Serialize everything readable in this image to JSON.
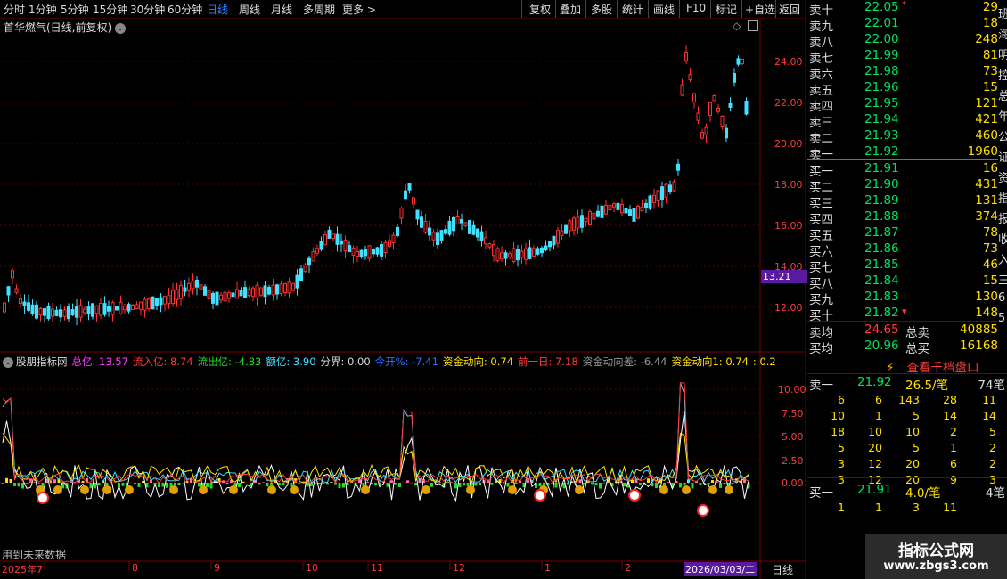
{
  "toolbar": {
    "periods": [
      "分时",
      "1分钟",
      "5分钟",
      "15分钟",
      "30分钟",
      "60分钟",
      "日线",
      "周线",
      "月线",
      "多周期",
      "更多 >"
    ],
    "active_period": "日线",
    "actions": [
      "复权",
      "叠加",
      "多股",
      "统计",
      "画线",
      "F10",
      "标记",
      "+自选",
      "返回"
    ]
  },
  "chart_title": "首华燃气(日线,前复权)",
  "price_axis": [
    "24.00",
    "22.00",
    "20.00",
    "18.00",
    "16.00",
    "14.00",
    "12.00"
  ],
  "current_price_tag": "13.21",
  "indicator": {
    "name": "股朋指标网",
    "fields": [
      {
        "label": "总亿: 13.57",
        "color": "#ff40ff"
      },
      {
        "label": "流入亿: 8.74",
        "color": "#ff3b3b"
      },
      {
        "label": "流出亿: -4.83",
        "color": "#22dd22"
      },
      {
        "label": "额亿: 3.90",
        "color": "#40e0ff"
      },
      {
        "label": "分界: 0.00",
        "color": "#dddddd"
      },
      {
        "label": "今开%: -7.41",
        "color": "#3070ff"
      },
      {
        "label": "资金动向: 0.74",
        "color": "#ffe000"
      },
      {
        "label": "前一日: 7.18",
        "color": "#ff3b3b"
      },
      {
        "label": "资金动向差: -6.44",
        "color": "#999999"
      },
      {
        "label": "资金动向1: 0.74",
        "color": "#ffe000"
      },
      {
        "label": ": 0.2",
        "color": "#ffe000"
      }
    ],
    "axis": [
      "10.00",
      "7.50",
      "5.00",
      "2.50",
      "0.00"
    ],
    "future_note": "用到未来数据"
  },
  "time_axis": [
    "2025年7",
    "8",
    "9",
    "10",
    "11",
    "12",
    "1",
    "2"
  ],
  "cursor_date": "2026/03/03/二",
  "period_label": "日线",
  "order_book": {
    "sells": [
      {
        "label": "卖十",
        "price": "22.05",
        "vol": "29"
      },
      {
        "label": "卖九",
        "price": "22.01",
        "vol": "18"
      },
      {
        "label": "卖八",
        "price": "22.00",
        "vol": "248"
      },
      {
        "label": "卖七",
        "price": "21.99",
        "vol": "81"
      },
      {
        "label": "卖六",
        "price": "21.98",
        "vol": "73"
      },
      {
        "label": "卖五",
        "price": "21.96",
        "vol": "15"
      },
      {
        "label": "卖四",
        "price": "21.95",
        "vol": "121"
      },
      {
        "label": "卖三",
        "price": "21.94",
        "vol": "421"
      },
      {
        "label": "卖二",
        "price": "21.93",
        "vol": "460"
      },
      {
        "label": "卖一",
        "price": "21.92",
        "vol": "1960"
      }
    ],
    "buys": [
      {
        "label": "买一",
        "price": "21.91",
        "vol": "16"
      },
      {
        "label": "买二",
        "price": "21.90",
        "vol": "431"
      },
      {
        "label": "买三",
        "price": "21.89",
        "vol": "131"
      },
      {
        "label": "买四",
        "price": "21.88",
        "vol": "374"
      },
      {
        "label": "买五",
        "price": "21.87",
        "vol": "78"
      },
      {
        "label": "买六",
        "price": "21.86",
        "vol": "73"
      },
      {
        "label": "买七",
        "price": "21.85",
        "vol": "46"
      },
      {
        "label": "买八",
        "price": "21.84",
        "vol": "15"
      },
      {
        "label": "买九",
        "price": "21.83",
        "vol": "130"
      },
      {
        "label": "买十",
        "price": "21.82",
        "vol": "148"
      }
    ],
    "avg_sell_label": "卖均",
    "avg_sell_price": "24.65",
    "total_sell_label": "总卖",
    "total_sell": "40885",
    "avg_buy_label": "买均",
    "avg_buy_price": "20.96",
    "total_buy_label": "总买",
    "total_buy": "16168"
  },
  "depth": {
    "button": "查看千档盘口",
    "sell1": {
      "label": "卖一",
      "price": "21.92",
      "per": "26.5/笔",
      "count": "74笔"
    },
    "sell_grid": [
      [
        "6",
        "6",
        "143",
        "28",
        "11"
      ],
      [
        "10",
        "1",
        "5",
        "14",
        "14"
      ],
      [
        "18",
        "10",
        "10",
        "2",
        "5"
      ],
      [
        "5",
        "20",
        "5",
        "1",
        "2"
      ],
      [
        "3",
        "12",
        "20",
        "6",
        "2"
      ],
      [
        "3",
        "12",
        "20",
        "9",
        "3"
      ]
    ],
    "buy1": {
      "label": "买一",
      "price": "21.91",
      "per": "4.0/笔",
      "count": "4笔"
    },
    "buy_grid": [
      [
        "1",
        "1",
        "3",
        "11"
      ]
    ]
  },
  "watermark": {
    "title": "指标公式网",
    "url": "www.zbgs3.com"
  },
  "edge_text": [
    "班",
    "海",
    "明",
    "控",
    "总",
    "年",
    "公",
    "证",
    "资",
    "指",
    "报",
    "收",
    "入",
    "三",
    "6",
    "5"
  ]
}
